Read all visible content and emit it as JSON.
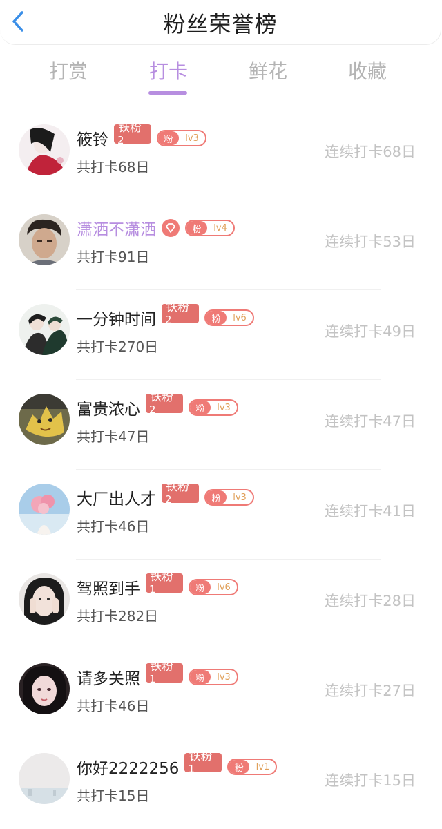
{
  "header": {
    "title": "粉丝荣誉榜"
  },
  "tabs": [
    {
      "label": "打赏",
      "active": false
    },
    {
      "label": "打卡",
      "active": true
    },
    {
      "label": "鲜花",
      "active": false
    },
    {
      "label": "收藏",
      "active": false
    }
  ],
  "colors": {
    "accent": "#b78ee0",
    "badge_red": "#e2706c",
    "fan_pink": "#ef7a76",
    "level_text": "#e0a05a",
    "streak_gray": "#c3c3c3"
  },
  "rows": [
    {
      "name": "筱铃",
      "tie_line1": "铁粉",
      "tie_line2": "2",
      "fan_label": "粉",
      "level": "lv3",
      "total": "共打卡68日",
      "streak": "连续打卡68日"
    },
    {
      "name": "潇洒不潇洒",
      "vip": true,
      "fan_label": "粉",
      "level": "lv4",
      "total": "共打卡91日",
      "streak": "连续打卡53日"
    },
    {
      "name": "一分钟时间",
      "tie_line1": "铁粉",
      "tie_line2": "2",
      "fan_label": "粉",
      "level": "lv6",
      "total": "共打卡270日",
      "streak": "连续打卡49日"
    },
    {
      "name": "富贵浓心",
      "tie_line1": "铁粉",
      "tie_line2": "2",
      "fan_label": "粉",
      "level": "lv3",
      "total": "共打卡47日",
      "streak": "连续打卡47日"
    },
    {
      "name": "大厂出人才",
      "tie_line1": "铁粉",
      "tie_line2": "2",
      "fan_label": "粉",
      "level": "lv3",
      "total": "共打卡46日",
      "streak": "连续打卡41日"
    },
    {
      "name": "驾照到手",
      "tie_line1": "铁粉",
      "tie_line2": "1",
      "fan_label": "粉",
      "level": "lv6",
      "total": "共打卡282日",
      "streak": "连续打卡28日"
    },
    {
      "name": "请多关照",
      "tie_line1": "铁粉",
      "tie_line2": "1",
      "fan_label": "粉",
      "level": "lv3",
      "total": "共打卡46日",
      "streak": "连续打卡27日"
    },
    {
      "name": "你好2222256",
      "tie_line1": "铁粉",
      "tie_line2": "1",
      "fan_label": "粉",
      "level": "lv1",
      "total": "共打卡15日",
      "streak": "连续打卡15日"
    }
  ]
}
